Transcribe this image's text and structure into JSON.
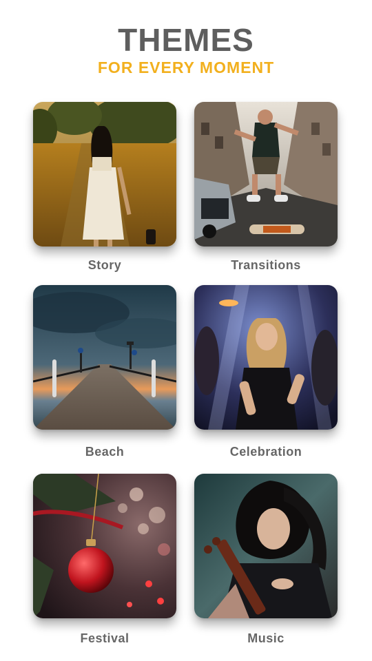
{
  "header": {
    "title": "THEMES",
    "subtitle": "FOR EVERY MOMENT"
  },
  "themes": [
    {
      "label": "Story",
      "image": "girl-walking-in-field-photo"
    },
    {
      "label": "Transitions",
      "image": "skateboarder-jumping-street-photo"
    },
    {
      "label": "Beach",
      "image": "wooden-pier-at-dusk-photo"
    },
    {
      "label": "Celebration",
      "image": "woman-dancing-at-party-photo"
    },
    {
      "label": "Festival",
      "image": "christmas-ornament-on-tree-photo"
    },
    {
      "label": "Music",
      "image": "woman-playing-string-instrument-photo"
    }
  ],
  "colors": {
    "title": "#5e5e5e",
    "subtitle": "#f2b01e",
    "label": "#666666",
    "background": "#ffffff"
  }
}
